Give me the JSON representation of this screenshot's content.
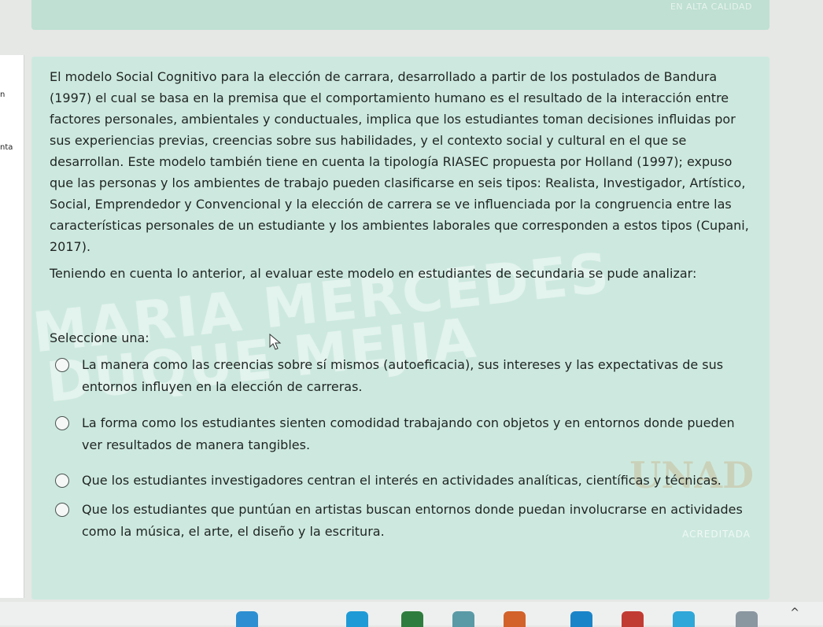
{
  "header": {
    "accreditation_text": "EN ALTA CALIDAD"
  },
  "left_strip": {
    "fragments": [
      "n",
      "nta"
    ]
  },
  "question": {
    "paragraph_1": "El modelo Social Cognitivo para la elección de carrara, desarrollado a partir de los postulados de Bandura (1997) el cual se basa en la premisa que el comportamiento humano es el resultado de la interacción entre factores personales, ambientales y conductuales, implica que los estudiantes toman decisiones influidas por sus experiencias previas, creencias sobre sus habilidades, y el contexto social y cultural en el que se desarrollan. Este modelo también tiene en cuenta la tipología RIASEC propuesta por Holland (1997); expuso que las personas y los ambientes de trabajo pueden clasificarse en seis tipos: Realista, Investigador, Artístico, Social, Emprendedor y Convencional y la elección de carrera se ve influenciada por la congruencia entre las características personales de un estudiante y los ambientes laborales que corresponden a estos tipos (Cupani, 2017).",
    "paragraph_2": "Teniendo en cuenta lo anterior, al evaluar este modelo en estudiantes de secundaria se pude analizar:",
    "prompt": "Seleccione una:",
    "options": [
      {
        "text": "La manera como las creencias sobre sí mismos (autoeficacia), sus intereses y las expectativas de sus entornos influyen en la elección de carreras."
      },
      {
        "text": "La forma como los estudiantes sienten comodidad trabajando con objetos y en entornos donde pueden ver resultados de manera tangibles."
      },
      {
        "text": "Que los estudiantes investigadores centran el interés en actividades analíticas, científicas y técnicas."
      },
      {
        "text": "Que los estudiantes que puntúan en artistas buscan entornos donde puedan involucrarse en actividades como la música, el arte, el diseño y la escritura."
      }
    ]
  },
  "watermark": {
    "line_1": "MARIA MERCEDES",
    "line_2": "DUQUE MEJIA"
  },
  "logo": {
    "text": "UNAD",
    "accreditation": "ACREDITADA"
  },
  "colors": {
    "card_bg": "#cde9df",
    "banner_bg": "#bfe0d3"
  }
}
